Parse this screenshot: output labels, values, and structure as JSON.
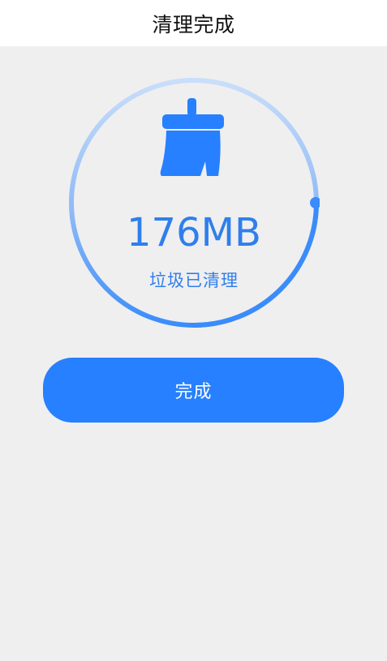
{
  "header": {
    "title": "清理完成"
  },
  "result": {
    "cleaned_size": "176MB",
    "cleaned_label": "垃圾已清理",
    "icon": "broom-icon"
  },
  "actions": {
    "done_label": "完成"
  },
  "colors": {
    "accent": "#2680FF",
    "text_accent": "#2F7FEC",
    "ring_light": "#C6DCF7",
    "background": "#EFEFF0",
    "header_background": "#FFFFFF"
  }
}
